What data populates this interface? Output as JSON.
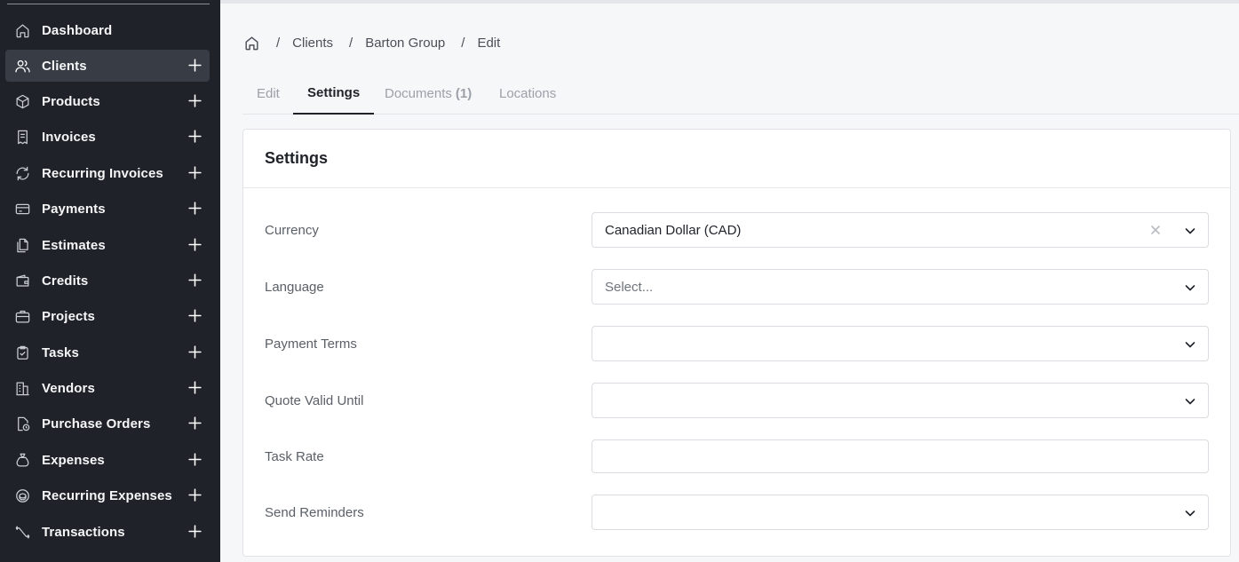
{
  "sidebar": {
    "items": [
      {
        "label": "Dashboard",
        "icon": "home-icon",
        "has_plus": false,
        "active": false
      },
      {
        "label": "Clients",
        "icon": "users-icon",
        "has_plus": true,
        "active": true
      },
      {
        "label": "Products",
        "icon": "box-icon",
        "has_plus": true,
        "active": false
      },
      {
        "label": "Invoices",
        "icon": "receipt-icon",
        "has_plus": true,
        "active": false
      },
      {
        "label": "Recurring Invoices",
        "icon": "refresh-icon",
        "has_plus": true,
        "active": false
      },
      {
        "label": "Payments",
        "icon": "credit-card-icon",
        "has_plus": true,
        "active": false
      },
      {
        "label": "Estimates",
        "icon": "files-icon",
        "has_plus": true,
        "active": false
      },
      {
        "label": "Credits",
        "icon": "wallet-icon",
        "has_plus": true,
        "active": false
      },
      {
        "label": "Projects",
        "icon": "briefcase-icon",
        "has_plus": true,
        "active": false
      },
      {
        "label": "Tasks",
        "icon": "clipboard-check-icon",
        "has_plus": true,
        "active": false
      },
      {
        "label": "Vendors",
        "icon": "building-icon",
        "has_plus": true,
        "active": false
      },
      {
        "label": "Purchase Orders",
        "icon": "file-clock-icon",
        "has_plus": true,
        "active": false
      },
      {
        "label": "Expenses",
        "icon": "money-bag-icon",
        "has_plus": true,
        "active": false
      },
      {
        "label": "Recurring Expenses",
        "icon": "coin-refresh-icon",
        "has_plus": true,
        "active": false
      },
      {
        "label": "Transactions",
        "icon": "arrows-exchange-icon",
        "has_plus": true,
        "active": false
      }
    ]
  },
  "breadcrumb": {
    "home_icon": "home-icon",
    "items": [
      "Clients",
      "Barton Group",
      "Edit"
    ],
    "separator": "/"
  },
  "tabs": [
    {
      "label": "Edit",
      "active": false
    },
    {
      "label": "Settings",
      "active": true
    },
    {
      "label": "Documents",
      "count": "(1)",
      "active": false
    },
    {
      "label": "Locations",
      "active": false
    }
  ],
  "card": {
    "title": "Settings",
    "fields": [
      {
        "label": "Currency",
        "value": "Canadian Dollar (CAD)",
        "type": "select",
        "clearable": true
      },
      {
        "label": "Language",
        "placeholder": "Select...",
        "type": "select"
      },
      {
        "label": "Payment Terms",
        "value": "",
        "type": "select"
      },
      {
        "label": "Quote Valid Until",
        "value": "",
        "type": "select"
      },
      {
        "label": "Task Rate",
        "value": "",
        "type": "input"
      },
      {
        "label": "Send Reminders",
        "value": "",
        "type": "select"
      }
    ]
  },
  "colors": {
    "sidebar_bg": "#1f2228",
    "sidebar_active": "#373c45",
    "text_primary": "#1f2228",
    "text_muted": "#9ca0a8"
  }
}
